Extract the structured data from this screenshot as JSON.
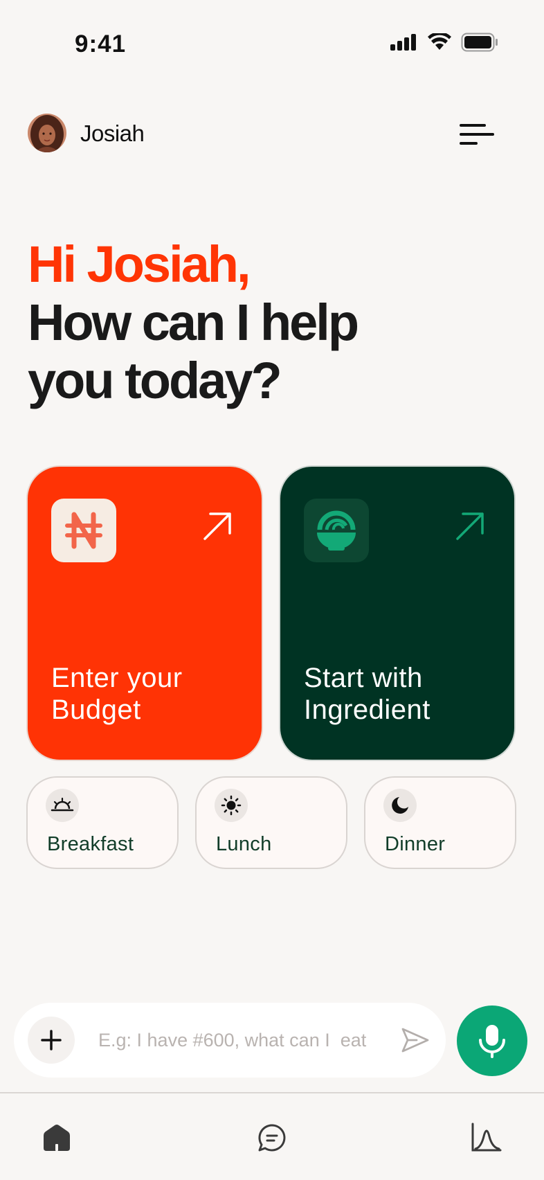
{
  "status_bar": {
    "time": "9:41"
  },
  "header": {
    "user_name": "Josiah"
  },
  "greeting": {
    "line1": "Hi Josiah,",
    "line2": "How can I help",
    "line3": "you today?"
  },
  "cards": [
    {
      "label_line1": "Enter your",
      "label_line2": "Budget",
      "icon": "naira-icon",
      "color": "#ff3305"
    },
    {
      "label_line1": "Start with",
      "label_line2": "Ingredient",
      "icon": "bowl-icon",
      "color": "#003323"
    }
  ],
  "meals": [
    {
      "label": "Breakfast",
      "icon": "sunrise-icon"
    },
    {
      "label": "Lunch",
      "icon": "sun-icon"
    },
    {
      "label": "Dinner",
      "icon": "moon-icon"
    }
  ],
  "chat": {
    "placeholder": "E.g: I have #600, what can I  eat"
  },
  "nav": {
    "items": [
      "home-icon",
      "chat-icon",
      "chart-icon"
    ]
  },
  "colors": {
    "accent": "#ff3505",
    "green": "#0ba776",
    "dark_green": "#003323"
  }
}
